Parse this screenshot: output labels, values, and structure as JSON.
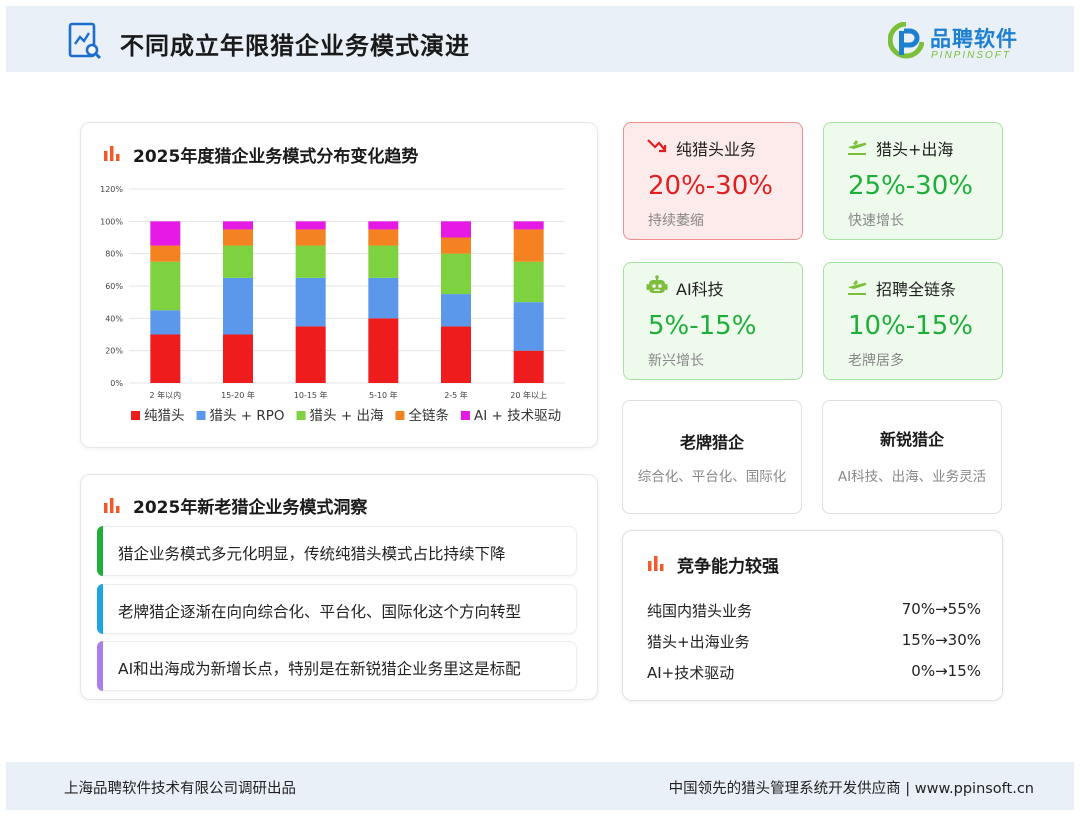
{
  "header": {
    "title": "不同成立年限猎企业务模式演进"
  },
  "logo": {
    "cn": "品聘软件",
    "en": "PINPINSOFT"
  },
  "chart_card": {
    "title": "2025年度猎企业务模式分布变化趋势"
  },
  "chart_data": {
    "type": "bar",
    "stacked": true,
    "title": "2025年度猎企业务模式分布变化趋势",
    "categories": [
      "2 年以内",
      "15-20 年",
      "10-15 年",
      "5-10 年",
      "2-5 年",
      "20 年以上"
    ],
    "series": [
      {
        "name": "纯猎头",
        "color": "#ee1c1c",
        "values": [
          30,
          30,
          35,
          40,
          35,
          20
        ]
      },
      {
        "name": "猎头 + RPO",
        "color": "#5b97ea",
        "values": [
          15,
          35,
          30,
          25,
          20,
          30
        ]
      },
      {
        "name": "猎头 + 出海",
        "color": "#7fd23f",
        "values": [
          30,
          20,
          20,
          20,
          25,
          25
        ]
      },
      {
        "name": "全链条",
        "color": "#f58220",
        "values": [
          10,
          10,
          10,
          10,
          10,
          20
        ]
      },
      {
        "name": "AI + 技术驱动",
        "color": "#e51be5",
        "values": [
          15,
          5,
          5,
          5,
          10,
          5
        ]
      }
    ],
    "yticks": [
      "0%",
      "20%",
      "40%",
      "60%",
      "80%",
      "100%",
      "120%"
    ],
    "ylim": [
      0,
      120
    ],
    "grid": true,
    "legend": "bottom"
  },
  "insights": {
    "title": "2025年新老猎企业务模式洞察",
    "items": [
      {
        "text": "猎企业务模式多元化明显，传统纯猎头模式占比持续下降",
        "color": "#1fae3a"
      },
      {
        "text": "老牌猎企逐渐在向向综合化、平台化、国际化这个方向转型",
        "color": "#1ea5e0"
      },
      {
        "text": "AI和出海成为新增长点，特别是在新锐猎企业务里这是标配",
        "color": "#a880e8"
      }
    ]
  },
  "kpis": [
    {
      "name": "纯猎头业务",
      "value": "20%-30%",
      "desc": "持续萎缩",
      "icon": "trend-down-icon",
      "tone": "red"
    },
    {
      "name": "猎头+出海",
      "value": "25%-30%",
      "desc": "快速增长",
      "icon": "plane-icon",
      "tone": "green"
    },
    {
      "name": "AI科技",
      "value": "5%-15%",
      "desc": "新兴增长",
      "icon": "robot-icon",
      "tone": "green"
    },
    {
      "name": "招聘全链条",
      "value": "10%-15%",
      "desc": "老牌居多",
      "icon": "plane-icon",
      "tone": "green"
    }
  ],
  "types": [
    {
      "name": "老牌猎企",
      "desc": "综合化、平台化、国际化"
    },
    {
      "name": "新锐猎企",
      "desc": "AI科技、出海、业务灵活"
    }
  ],
  "competition": {
    "title": "竞争能力较强",
    "rows": [
      {
        "label": "纯国内猎头业务",
        "value": "70%→55%"
      },
      {
        "label": "猎头+出海业务",
        "value": "15%→30%"
      },
      {
        "label": "AI+技术驱动",
        "value": "0%→15%"
      }
    ]
  },
  "footer": {
    "left": "上海品聘软件技术有限公司调研出品",
    "right": "中国领先的猎头管理系统开发供应商 |  www.ppinsoft.cn"
  }
}
